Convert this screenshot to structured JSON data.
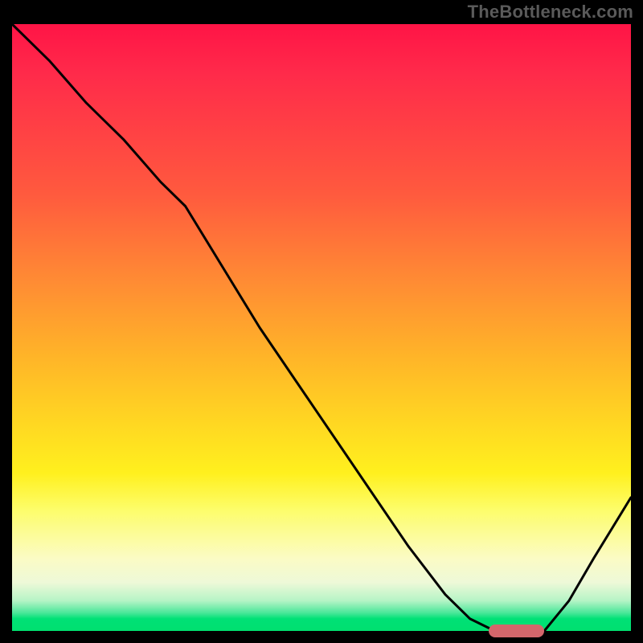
{
  "watermark": "TheBottleneck.com",
  "marker": {
    "color": "#d3666b"
  },
  "chart_data": {
    "type": "line",
    "title": "",
    "xlabel": "",
    "ylabel": "",
    "xlim": [
      0,
      100
    ],
    "ylim": [
      0,
      100
    ],
    "grid": false,
    "legend": null,
    "series": [
      {
        "name": "bottleneck-curve",
        "x": [
          0,
          6,
          12,
          18,
          24,
          28,
          34,
          40,
          46,
          52,
          58,
          64,
          70,
          74,
          78,
          82,
          86,
          90,
          94,
          100
        ],
        "y": [
          100,
          94,
          87,
          81,
          74,
          70,
          60,
          50,
          41,
          32,
          23,
          14,
          6,
          2,
          0,
          0,
          0,
          5,
          12,
          22
        ]
      }
    ],
    "annotations": [
      {
        "kind": "optimal-marker",
        "x_range": [
          77,
          86
        ],
        "y": 0
      }
    ]
  }
}
